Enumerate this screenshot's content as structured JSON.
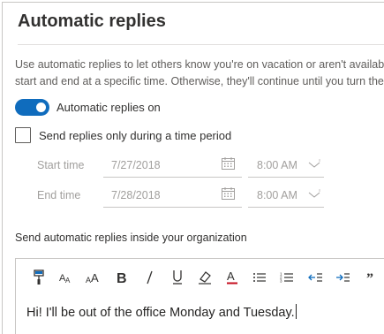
{
  "page": {
    "title": "Automatic replies",
    "description_line1": "Use automatic replies to let others know you're on vacation or aren't available",
    "description_line2": "start and end at a specific time. Otherwise, they'll continue until you turn ther"
  },
  "toggle": {
    "label": "Automatic replies on",
    "state": "on",
    "accent": "#0f6cbd"
  },
  "time_period": {
    "checkbox_label": "Send replies only during a time period",
    "checked": false,
    "start": {
      "label": "Start time",
      "date": "7/27/2018",
      "time": "8:00 AM"
    },
    "end": {
      "label": "End time",
      "date": "7/28/2018",
      "time": "8:00 AM"
    }
  },
  "inside_org": {
    "label": "Send automatic replies inside your organization",
    "toolbar": [
      "format-painter-icon",
      "font-size-decrease-icon",
      "font-size-increase-icon",
      "bold-icon",
      "italic-icon",
      "underline-icon",
      "highlight-icon",
      "font-color-icon",
      "bullets-icon",
      "numbering-icon",
      "decrease-indent-icon",
      "increase-indent-icon",
      "quote-icon"
    ],
    "message": "Hi! I'll be out of the office Monday and Tuesday."
  }
}
